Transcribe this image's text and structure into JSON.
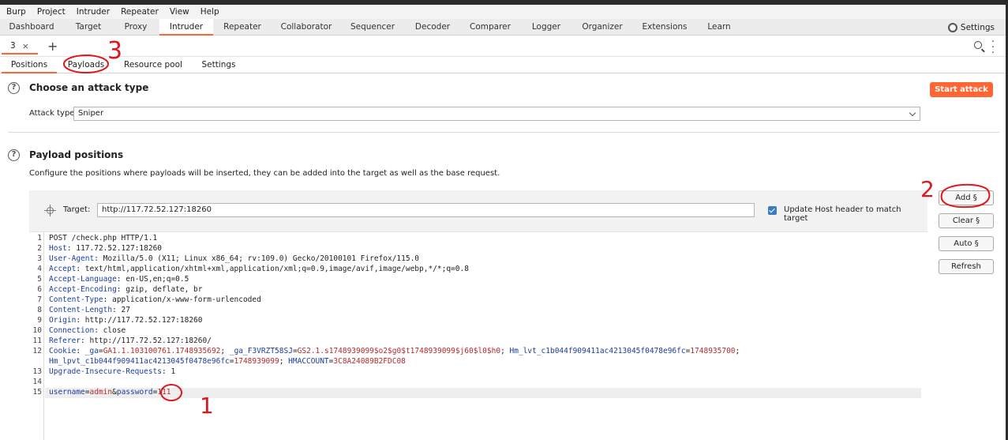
{
  "menu": [
    "Burp",
    "Project",
    "Intruder",
    "Repeater",
    "View",
    "Help"
  ],
  "main_tabs": [
    "Dashboard",
    "Target",
    "Proxy",
    "Intruder",
    "Repeater",
    "Collaborator",
    "Sequencer",
    "Decoder",
    "Comparer",
    "Logger",
    "Organizer",
    "Extensions",
    "Learn"
  ],
  "settings_label": "Settings",
  "instance_tab": {
    "label": "3",
    "close": "×"
  },
  "new_tab": "+",
  "sub_tabs": [
    "Positions",
    "Payloads",
    "Resource pool",
    "Settings"
  ],
  "attack_type": {
    "title": "Choose an attack type",
    "label": "Attack type:",
    "value": "Sniper",
    "start_label": "Start attack"
  },
  "positions": {
    "title": "Payload positions",
    "description": "Configure the positions where payloads will be inserted, they can be added into the target as well as the base request.",
    "target_label": "Target:",
    "target_value": "http://117.72.52.127:18260",
    "update_host_label": "Update Host header to match target",
    "update_host_checked": true
  },
  "side_buttons": [
    "Add §",
    "Clear §",
    "Auto §",
    "Refresh"
  ],
  "request": {
    "line_numbers": [
      "1",
      "2",
      "3",
      "4",
      "5",
      "6",
      "7",
      "8",
      "9",
      "10",
      "11",
      "12",
      "13",
      "14",
      "15"
    ],
    "request_line": "POST /check.php HTTP/1.1",
    "headers": [
      {
        "name": "Host",
        "value": " 117.72.52.127:18260"
      },
      {
        "name": "User-Agent",
        "value": " Mozilla/5.0 (X11; Linux x86_64; rv:109.0) Gecko/20100101 Firefox/115.0"
      },
      {
        "name": "Accept",
        "value": " text/html,application/xhtml+xml,application/xml;q=0.9,image/avif,image/webp,*/*;q=0.8"
      },
      {
        "name": "Accept-Language",
        "value": " en-US,en;q=0.5"
      },
      {
        "name": "Accept-Encoding",
        "value": " gzip, deflate, br"
      },
      {
        "name": "Content-Type",
        "value": " application/x-www-form-urlencoded"
      },
      {
        "name": "Content-Length",
        "value": " 27"
      },
      {
        "name": "Origin",
        "value": " http://117.72.52.127:18260"
      },
      {
        "name": "Connection",
        "value": " close"
      },
      {
        "name": "Referer",
        "value": " http://117.72.52.127:18260/"
      }
    ],
    "cookie_name": "Cookie",
    "cookies": [
      {
        "k": "_ga",
        "v": "GA1.1.103100761.1748935692"
      },
      {
        "k": "_ga_F3VRZT58SJ",
        "v": "GS2.1.s1748939099$o2$g0$t1748939099$j60$l0$h0"
      },
      {
        "k": "Hm_lvt_c1b044f909411ac4213045f0478e96fc",
        "v": "1748935700"
      },
      {
        "k": "Hm_lpvt_c1b044f909411ac4213045f0478e96fc",
        "v": "1748939099"
      },
      {
        "k": "HMACCOUNT",
        "v": "3C8A24089B2FDC08"
      }
    ],
    "upgrade_name": "Upgrade-Insecure-Requests",
    "upgrade_value": " 1",
    "body": {
      "k1": "username",
      "v1": "admin",
      "k2": "password",
      "v2": "111"
    }
  },
  "annotations": [
    "1",
    "2",
    "3"
  ]
}
